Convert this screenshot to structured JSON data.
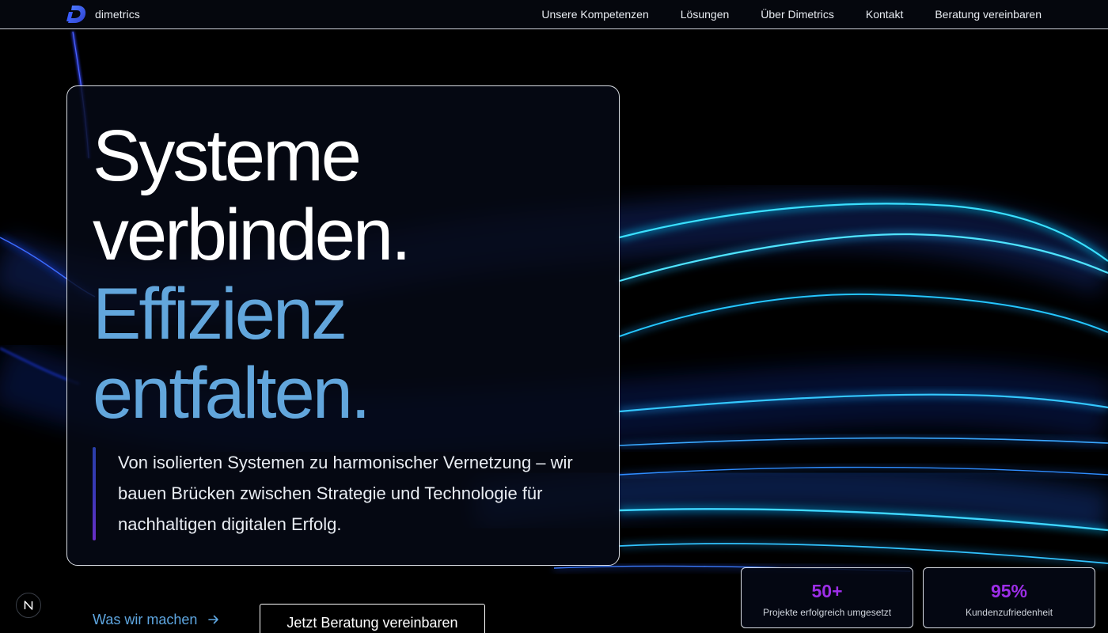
{
  "theme": {
    "accent_blue": "#62a6dc",
    "stat_purple": "#9d2ee8",
    "background": "#000000"
  },
  "navbar": {
    "brand_name": "dimetrics",
    "brand_icon": "dimetrics-logo-icon",
    "links": [
      {
        "label": "Unsere Kompetenzen"
      },
      {
        "label": "Lösungen"
      },
      {
        "label": "Über Dimetrics"
      },
      {
        "label": "Kontakt"
      },
      {
        "label": "Beratung vereinbaren"
      }
    ]
  },
  "hero": {
    "headline_line1": "Systeme",
    "headline_line2": "verbinden.",
    "headline_line3": "Effizienz",
    "headline_line4": "entfalten.",
    "subtext": "Von isolierten Systemen zu harmonischer Vernetzung – wir bauen Brücken zwischen Strategie und Technologie für nachhaltigen digitalen Erfolg."
  },
  "cta": {
    "secondary_label": "Was wir machen",
    "secondary_icon": "arrow-right-icon",
    "primary_label": "Jetzt Beratung vereinbaren"
  },
  "stats": [
    {
      "value": "50+",
      "label": "Projekte erfolgreich umgesetzt"
    },
    {
      "value": "95%",
      "label": "Kundenzufriedenheit"
    }
  ],
  "floating_badge": {
    "icon": "n-logo-icon",
    "letter": "N"
  }
}
